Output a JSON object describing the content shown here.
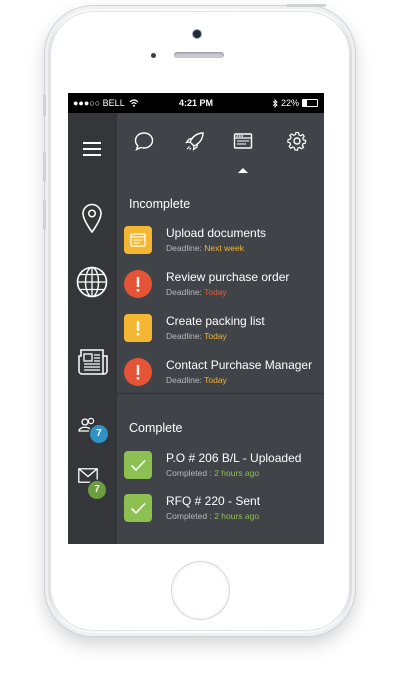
{
  "status": {
    "carrier": "●●●○○ BELL",
    "time": "4:21 PM",
    "battery": "22%"
  },
  "sidebar": {
    "badges": {
      "contacts": "7",
      "mail": "7"
    }
  },
  "sections": {
    "incomplete_title": "Incomplete",
    "complete_title": "Complete"
  },
  "incomplete": [
    {
      "title": "Upload documents",
      "label": "Deadline:",
      "value": "Next week",
      "value_color": "#f2b233",
      "icon": "document-icon",
      "icon_color": "#f5b731"
    },
    {
      "title": "Review purchase order",
      "label": "Deadline:",
      "value": "Today",
      "value_color": "#ea5a3c",
      "icon": "exclamation-icon",
      "icon_color": "#e55437"
    },
    {
      "title": "Create packing list",
      "label": "Deadline:",
      "value": "Today",
      "value_color": "#f2b233",
      "icon": "exclamation-icon",
      "icon_color": "#f5b731"
    },
    {
      "title": "Contact Purchase Manager",
      "label": "Deadline:",
      "value": "Today",
      "value_color": "#f2b233",
      "icon": "exclamation-icon",
      "icon_color": "#e55437"
    }
  ],
  "complete": [
    {
      "title": "P.O # 206 B/L - Uploaded",
      "label": "Completed :",
      "value": "2 hours ago",
      "value_color": "#8cc152",
      "icon": "checkmark-icon",
      "icon_color": "#8cc152"
    },
    {
      "title": "RFQ # 220 - Sent",
      "label": "Completed :",
      "value": "2 hours ago",
      "value_color": "#8cc152",
      "icon": "checkmark-icon",
      "icon_color": "#8cc152"
    }
  ],
  "colors": {
    "badge_blue": "#2f93c4",
    "badge_green": "#6a9e3e"
  }
}
